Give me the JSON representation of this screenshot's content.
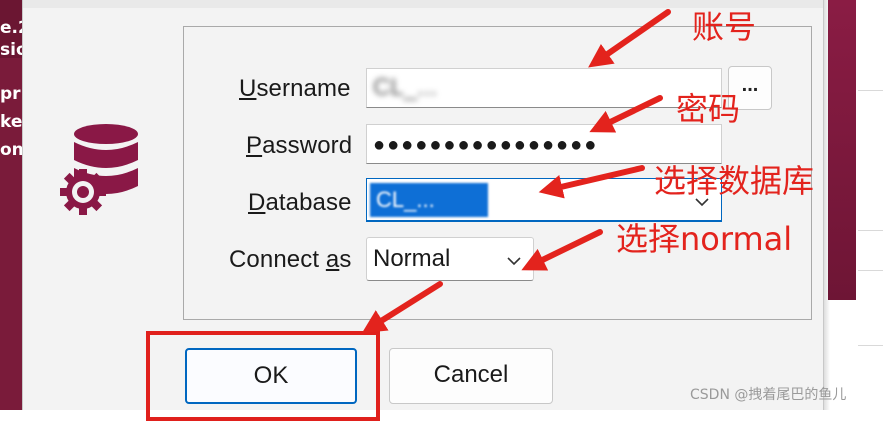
{
  "background_app": {
    "left_fragments": [
      "e.2",
      "sio",
      "pr",
      "ke",
      "on"
    ],
    "accent": "#7a1b3a"
  },
  "dialog": {
    "icon": "database-gear-icon",
    "fields": {
      "username": {
        "label_u": "U",
        "label_rest": "sername",
        "value": "CL_..."
      },
      "password": {
        "label_u": "P",
        "label_rest": "assword",
        "value": "●●●●●●●●●●●●●●●●"
      },
      "database": {
        "label_pre": "D",
        "label_rest": "atabase",
        "value": "CL_..."
      },
      "connect_as": {
        "label_pre": "Connect ",
        "label_u": "a",
        "label_rest": "s",
        "value": "Normal"
      }
    },
    "ellipsis_label": "...",
    "buttons": {
      "ok": "OK",
      "cancel": "Cancel"
    },
    "accent_color": "#0067c0"
  },
  "annotations": {
    "account": "账号",
    "password": "密码",
    "select_database": "选择数据库",
    "select_normal": "选择normal",
    "color": "#e3231d"
  },
  "watermark": "CSDN @拽着尾巴的鱼儿"
}
